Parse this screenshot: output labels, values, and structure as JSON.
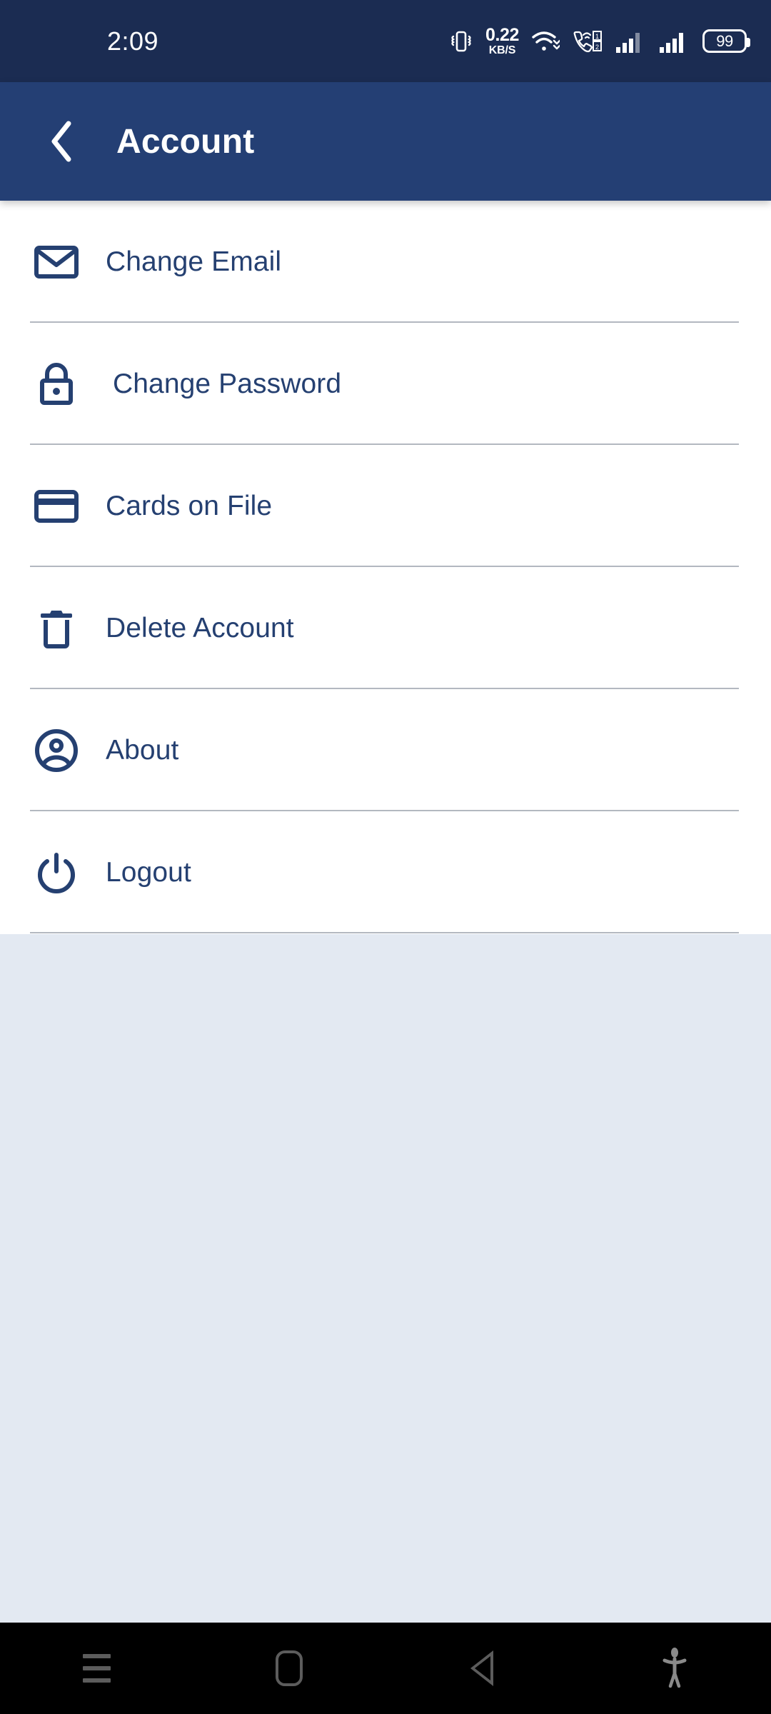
{
  "statusbar": {
    "time": "2:09",
    "network_speed_value": "0.22",
    "network_speed_unit": "KB/S",
    "battery_level": "99",
    "icons": [
      "vibrate-icon",
      "network-speed-icon",
      "wifi-icon",
      "volte-sim-icon",
      "signal-sim1-icon",
      "signal-sim2-icon",
      "battery-icon"
    ],
    "background_color": "#1b2c52"
  },
  "header": {
    "title": "Account",
    "back_icon": "chevron-left-icon",
    "background_color": "#243f74",
    "text_color": "#ffffff"
  },
  "menu": {
    "accent_color": "#254071",
    "items": [
      {
        "label": "Change Email",
        "icon": "mail-icon"
      },
      {
        "label": "Change Password",
        "icon": "lock-icon"
      },
      {
        "label": "Cards on File",
        "icon": "credit-card-icon"
      },
      {
        "label": "Delete Account",
        "icon": "trash-icon"
      },
      {
        "label": "About",
        "icon": "account-circle-icon"
      },
      {
        "label": "Logout",
        "icon": "power-icon"
      }
    ]
  },
  "page_background_color": "#e3e9f2",
  "navbar": {
    "background_color": "#000000",
    "buttons": [
      {
        "name": "recents-button",
        "icon": "menu-lines-icon"
      },
      {
        "name": "home-button",
        "icon": "home-square-icon"
      },
      {
        "name": "back-button",
        "icon": "back-triangle-icon"
      },
      {
        "name": "accessibility-button",
        "icon": "accessibility-person-icon"
      }
    ]
  }
}
